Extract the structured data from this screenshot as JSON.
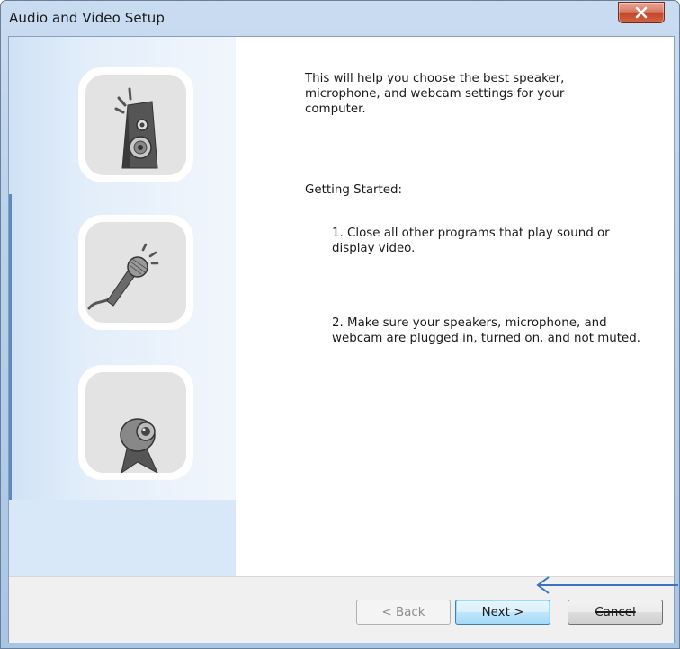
{
  "window": {
    "title": "Audio and Video Setup",
    "close_icon": "close-x-icon"
  },
  "sidebar": {
    "icons": [
      {
        "name": "speaker-icon"
      },
      {
        "name": "microphone-icon"
      },
      {
        "name": "webcam-icon"
      }
    ]
  },
  "content": {
    "intro": "This will help you choose the best speaker, microphone, and webcam settings for your computer.",
    "heading": "Getting Started:",
    "step1": "1. Close all other programs that play sound or display video.",
    "step2": "2. Make sure your speakers, microphone, and webcam are plugged in, turned on, and not muted."
  },
  "footer": {
    "back_label": "< Back",
    "back_enabled": false,
    "next_label": "Next >",
    "cancel_label": "Cancel"
  },
  "colors": {
    "title_bar": "#b9d1ec",
    "close_button": "#c2452b",
    "annotation_arrow": "#3a73c4"
  }
}
